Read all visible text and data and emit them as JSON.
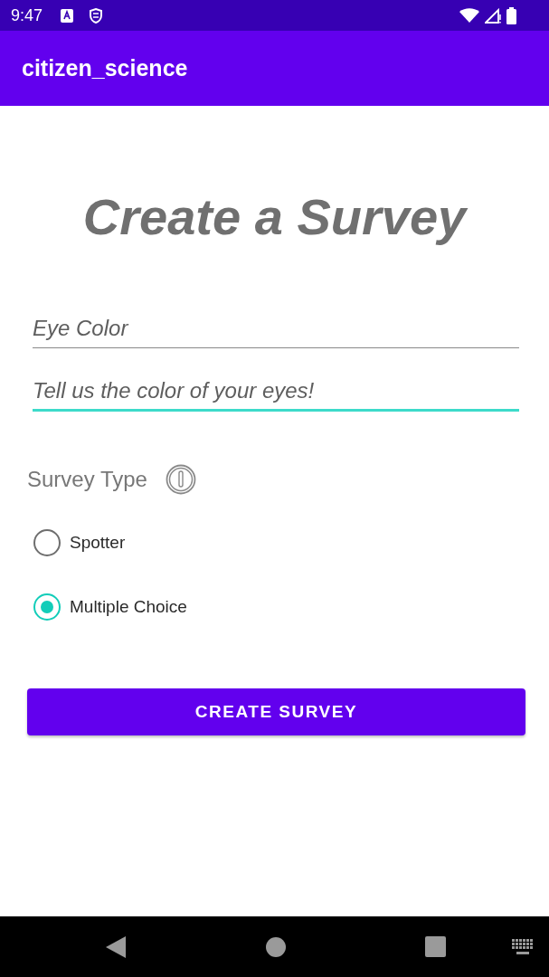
{
  "status_bar": {
    "time": "9:47"
  },
  "app_bar": {
    "title": "citizen_science"
  },
  "heading": "Create a Survey",
  "fields": [
    {
      "placeholder": "Eye Color",
      "focused": false
    },
    {
      "placeholder": "Tell us the color of your eyes!",
      "focused": true
    }
  ],
  "survey_type": {
    "label": "Survey Type",
    "options": [
      {
        "label": "Spotter",
        "selected": false
      },
      {
        "label": "Multiple Choice",
        "selected": true
      }
    ]
  },
  "button": "CREATE SURVEY"
}
